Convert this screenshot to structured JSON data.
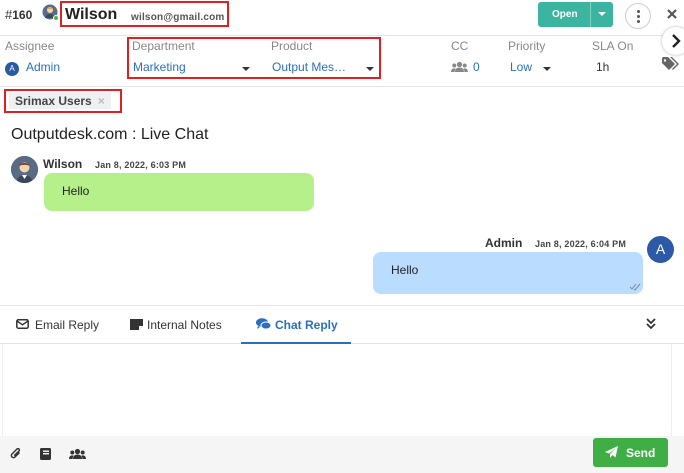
{
  "ticket": {
    "hash": "#",
    "number": "160",
    "customer_name": "Wilson",
    "customer_email": "wilson@gmail.com",
    "status_button": "Open"
  },
  "meta": {
    "assignee_label": "Assignee",
    "assignee_initial": "A",
    "assignee_value": "Admin",
    "department_label": "Department",
    "department_value": "Marketing",
    "product_label": "Product",
    "product_value": "Output Mes…",
    "cc_label": "CC",
    "cc_value": "0",
    "priority_label": "Priority",
    "priority_value": "Low",
    "sla_label": "SLA On",
    "sla_value": "1h"
  },
  "tags": {
    "group_chip": "Srimax Users",
    "chip_remove": "×"
  },
  "chat": {
    "title": "Outputdesk.com : Live Chat",
    "messages": [
      {
        "sender": "Wilson",
        "time": "Jan 8, 2022, 6:03 PM",
        "text": "Hello"
      },
      {
        "sender": "Admin",
        "avatar_initial": "A",
        "time": "Jan 8, 2022, 6:04 PM",
        "text": "Hello"
      }
    ]
  },
  "reply_tabs": {
    "email_reply": "Email Reply",
    "internal_notes": "Internal Notes",
    "chat_reply": "Chat Reply"
  },
  "footer": {
    "send_label": "Send"
  },
  "colors": {
    "accent_blue": "#2a6fbf",
    "open_button": "#3cb5a0",
    "send_button": "#3fae45",
    "incoming_bubble": "#b5f08a",
    "outgoing_bubble": "#b9dcff",
    "highlight_border": "#e02020"
  },
  "icons": {
    "header": [
      "user-avatar-icon",
      "kebab-menu-icon",
      "close-icon"
    ],
    "meta": [
      "users-icon",
      "chevron-right-icon",
      "tags-icon"
    ],
    "tabs": [
      "envelope-icon",
      "note-icon",
      "comments-icon",
      "double-chevron-down-icon"
    ],
    "footer": [
      "paperclip-icon",
      "book-icon",
      "users-icon",
      "paper-plane-icon"
    ]
  }
}
